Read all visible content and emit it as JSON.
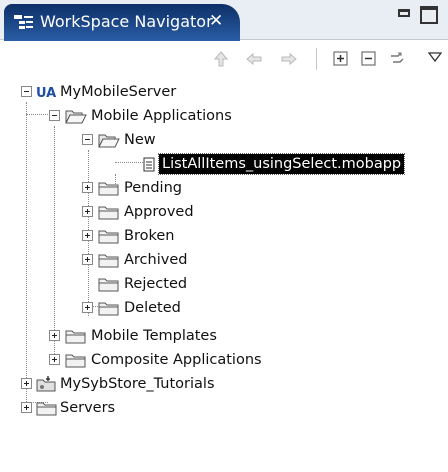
{
  "view": {
    "title": "WorkSpace Navigator",
    "close_glyph": "✕",
    "tab_icon": "navigator-icon"
  },
  "toolbar": {
    "buttons": [
      "up-arrow-icon",
      "back-arrow-icon",
      "forward-arrow-icon",
      "expand-all-icon",
      "collapse-all-icon",
      "link-with-editor-icon",
      "view-menu-icon"
    ]
  },
  "tree": {
    "server": "MyMobileServer",
    "mobile_applications": "Mobile Applications",
    "new": "New",
    "selected_file": "ListAllItems_usingSelect.mobapp",
    "pending": "Pending",
    "approved": "Approved",
    "broken": "Broken",
    "archived": "Archived",
    "rejected": "Rejected",
    "deleted": "Deleted",
    "mobile_templates": "Mobile Templates",
    "composite_applications": "Composite Applications",
    "store_project": "MySybStore_Tutorials",
    "servers": "Servers"
  },
  "colors": {
    "tab_active": "#1c4a8c",
    "selection": "#000000",
    "folder_fill": "#f2f2f2",
    "server_icon": "#1f4fa3"
  }
}
